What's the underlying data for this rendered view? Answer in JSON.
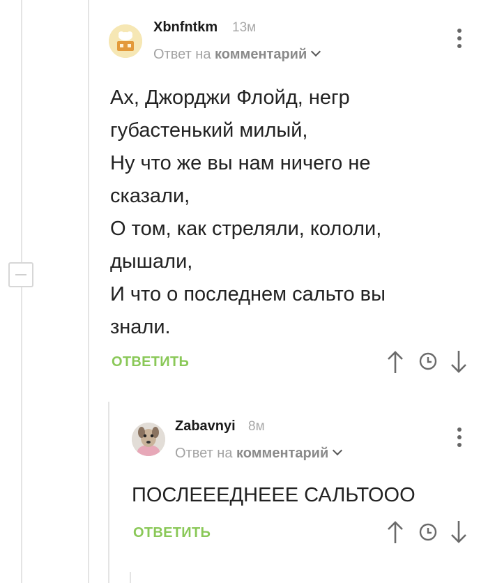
{
  "comments": [
    {
      "author": "Xbnfntkm",
      "time": "13м",
      "reply_prefix": "Ответ на",
      "reply_target": "комментарий",
      "text": "Ах, Джорджи Флойд, негр\nгубастенький милый,\nНу что же вы нам ничего не\nсказали,\nО том, как стреляли, кололи,\nдышали,\nИ что о последнем сальто вы\nзнали.",
      "reply_label": "ОТВЕТИТЬ"
    },
    {
      "author": "Zabavnyi",
      "time": "8м",
      "reply_prefix": "Ответ на",
      "reply_target": "комментарий",
      "text": "ПОСЛЕЕЕДНЕЕЕ САЛЬТОOO",
      "reply_label": "ОТВЕТИТЬ"
    }
  ],
  "icons": {
    "upvote": "arrow-up-icon",
    "sort": "clock-icon",
    "downvote": "arrow-down-icon",
    "more": "kebab-menu-icon",
    "expand": "chevron-down-icon",
    "collapse": "minus-icon"
  },
  "colors": {
    "reply_green": "#8ac858",
    "thread_line": "#e4e4e4",
    "muted_text": "#a3a3a3"
  }
}
